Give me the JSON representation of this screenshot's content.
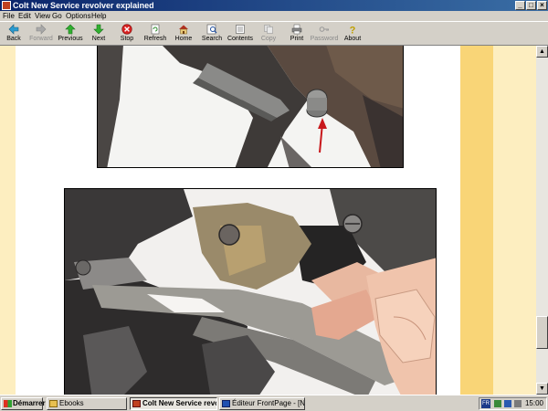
{
  "window": {
    "title": "Colt New Service revolver explained",
    "controls": [
      "_",
      "□",
      "×"
    ]
  },
  "menu": {
    "items": [
      "File",
      "Edit",
      "View",
      "Go",
      "Options",
      "Help"
    ]
  },
  "toolbar": {
    "back": "Back",
    "forward": "Forward",
    "previous": "Previous",
    "next": "Next",
    "stop": "Stop",
    "refresh": "Refresh",
    "home": "Home",
    "search": "Search",
    "contents": "Contents",
    "copy": "Copy",
    "print": "Print",
    "password": "Password",
    "about": "About"
  },
  "colors": {
    "page_background": "#fdeec0",
    "accent_strip": "#f9d577",
    "annotation_arrow": "#c8181c"
  },
  "taskbar": {
    "start": "Démarrer",
    "tasks": [
      {
        "label": "Ebooks",
        "active": false
      },
      {
        "label": "Colt New Service revo...",
        "active": true
      },
      {
        "label": "Éditeur FrontPage - [Nouv...",
        "active": false
      }
    ],
    "language": "FR",
    "clock": "15:00"
  }
}
